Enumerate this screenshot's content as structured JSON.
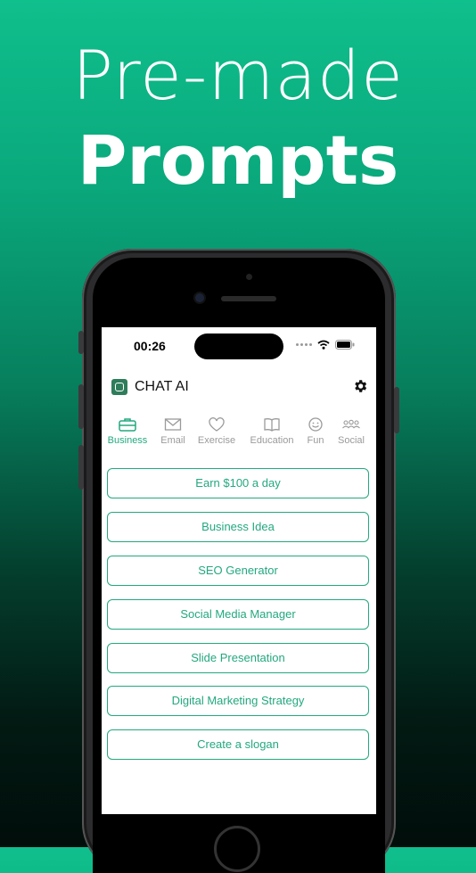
{
  "promo": {
    "line1": "Pre-made",
    "line2": "Prompts"
  },
  "status_bar": {
    "time": "00:26"
  },
  "app_bar": {
    "title": "CHAT AI"
  },
  "tabs": [
    {
      "label": "Business",
      "icon": "briefcase-icon",
      "active": true
    },
    {
      "label": "Email",
      "icon": "envelope-icon",
      "active": false
    },
    {
      "label": "Exercise",
      "icon": "heart-icon",
      "active": false
    },
    {
      "label": "Education",
      "icon": "book-icon",
      "active": false
    },
    {
      "label": "Fun",
      "icon": "smiley-icon",
      "active": false
    },
    {
      "label": "Social",
      "icon": "people-icon",
      "active": false
    }
  ],
  "prompts": [
    "Earn $100 a day",
    "Business Idea",
    "SEO Generator",
    "Social Media Manager",
    "Slide Presentation",
    "Digital Marketing Strategy",
    "Create a slogan"
  ],
  "colors": {
    "accent": "#23a87f",
    "background_top": "#0fbf8c",
    "background_bottom": "#010d0a"
  }
}
